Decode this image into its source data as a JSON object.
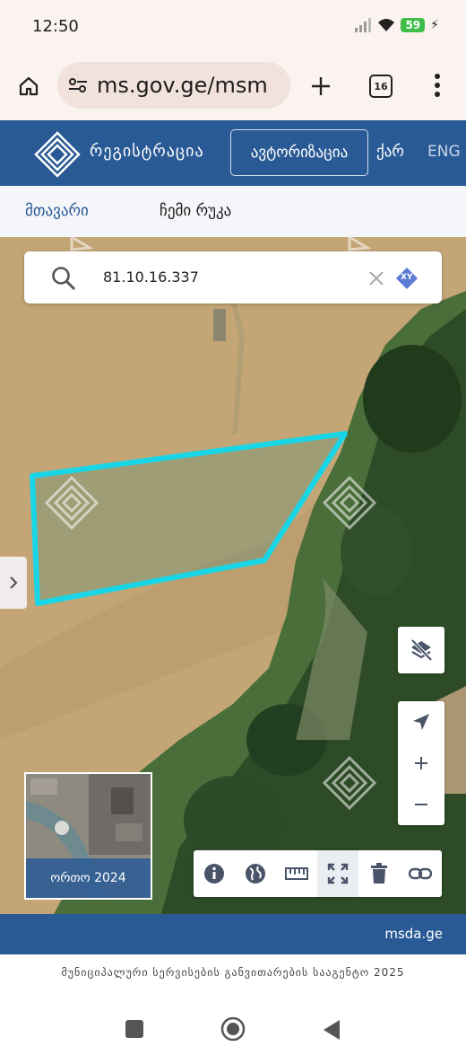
{
  "status_bar": {
    "time": "12:50",
    "battery": "59"
  },
  "browser": {
    "url": "ms.gov.ge/msm",
    "tab_count": "16"
  },
  "header": {
    "brand": "რეგისტრაცია",
    "login": "ავტორიზაცია",
    "lang_ka": "ქარ",
    "lang_en": "ENG"
  },
  "nav": {
    "home": "მთავარი",
    "my_map": "ჩემი რუკა"
  },
  "map": {
    "search_value": "81.10.16.337",
    "xy_badge": "XY",
    "minimap_label": "ორთო 2024",
    "parcel_color": "#19d6e6"
  },
  "footer": {
    "link": "msda.ge",
    "copyright": "მუნიციპალური სერვისების განვითარების სააგენტო 2025"
  },
  "colors": {
    "brand": "#2a5a95",
    "accent": "#19d6e6"
  }
}
